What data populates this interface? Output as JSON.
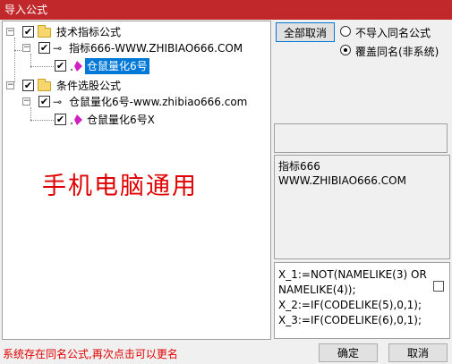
{
  "window": {
    "title": "导入公式"
  },
  "tree": {
    "nodes": [
      {
        "label": "技术指标公式",
        "checked": "✔",
        "expander": "−"
      },
      {
        "label": "指标666-WWW.ZHIBIAO666.COM",
        "checked": "✔",
        "expander": "−"
      },
      {
        "label": "仓鼠量化6号",
        "checked": "✔",
        "selected": true
      },
      {
        "label": "条件选股公式",
        "checked": "✔",
        "expander": "−"
      },
      {
        "label": "仓鼠量化6号-www.zhibiao666.com",
        "checked": "✔",
        "expander": "−"
      },
      {
        "label": "仓鼠量化6号X",
        "checked": "✔"
      }
    ]
  },
  "watermark": "手机电脑通用",
  "options": {
    "cancel_all_label": "全部取消",
    "radio_no_import_label": "不导入同名公式",
    "radio_overwrite_label": "覆盖同名(非系统)",
    "selected": "overwrite"
  },
  "info": {
    "lines": [
      "指标666",
      "WWW.ZHIBIAO666.COM"
    ]
  },
  "code": {
    "lines": [
      "X_1:=NOT(NAMELIKE(3) OR",
      "NAMELIKE(4));",
      "X_2:=IF(CODELIKE(5),0,1);",
      "X_3:=IF(CODELIKE(6),0,1);"
    ]
  },
  "status_text": "系统存在同名公式,再次点击可以更名",
  "buttons": {
    "ok_label": "确定",
    "cancel_label": "取消"
  },
  "colors": {
    "title_bar": "#c1282b",
    "selection": "#0078d7",
    "warning_text": "#e00000"
  }
}
